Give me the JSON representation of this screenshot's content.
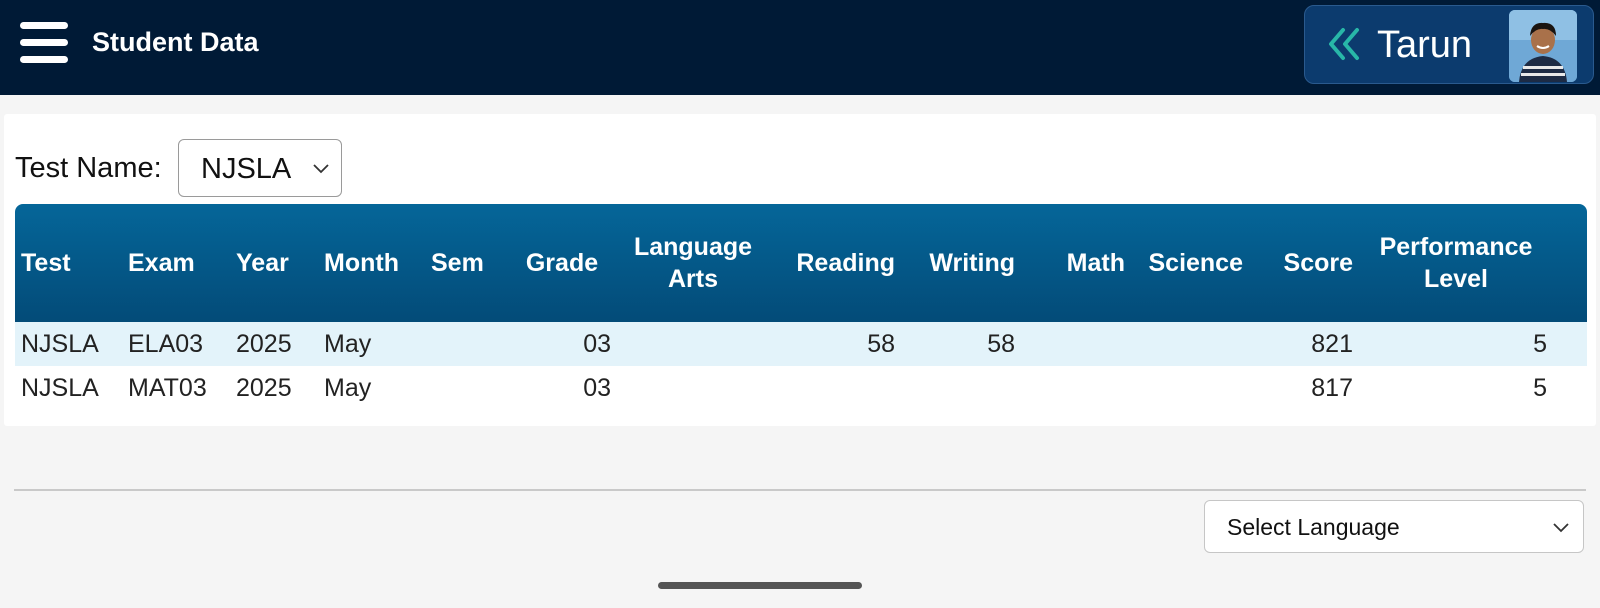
{
  "header": {
    "title": "Student Data",
    "user_name": "Tarun",
    "back_icon": "double-chevron-left-icon",
    "menu_icon": "hamburger-menu-icon",
    "colors": {
      "bar": "#001a36",
      "chip": "#0c3b6e",
      "chevron": "#28b7a8"
    }
  },
  "filter": {
    "label": "Test Name:",
    "selected": "NJSLA"
  },
  "table": {
    "header_color": "#056699",
    "columns": [
      "Test",
      "Exam",
      "Year",
      "Month",
      "Sem",
      "Grade",
      "Language Arts",
      "Reading",
      "Writing",
      "Math",
      "Science",
      "Score",
      "Performance Level"
    ],
    "rows": [
      [
        "NJSLA",
        "ELA03",
        "2025",
        "May",
        "",
        "03",
        "",
        "58",
        "58",
        "",
        "",
        "821",
        "5"
      ],
      [
        "NJSLA",
        "MAT03",
        "2025",
        "May",
        "",
        "03",
        "",
        "",
        "",
        "",
        "",
        "817",
        "5"
      ]
    ]
  },
  "footer": {
    "language_selected": "Select Language"
  }
}
